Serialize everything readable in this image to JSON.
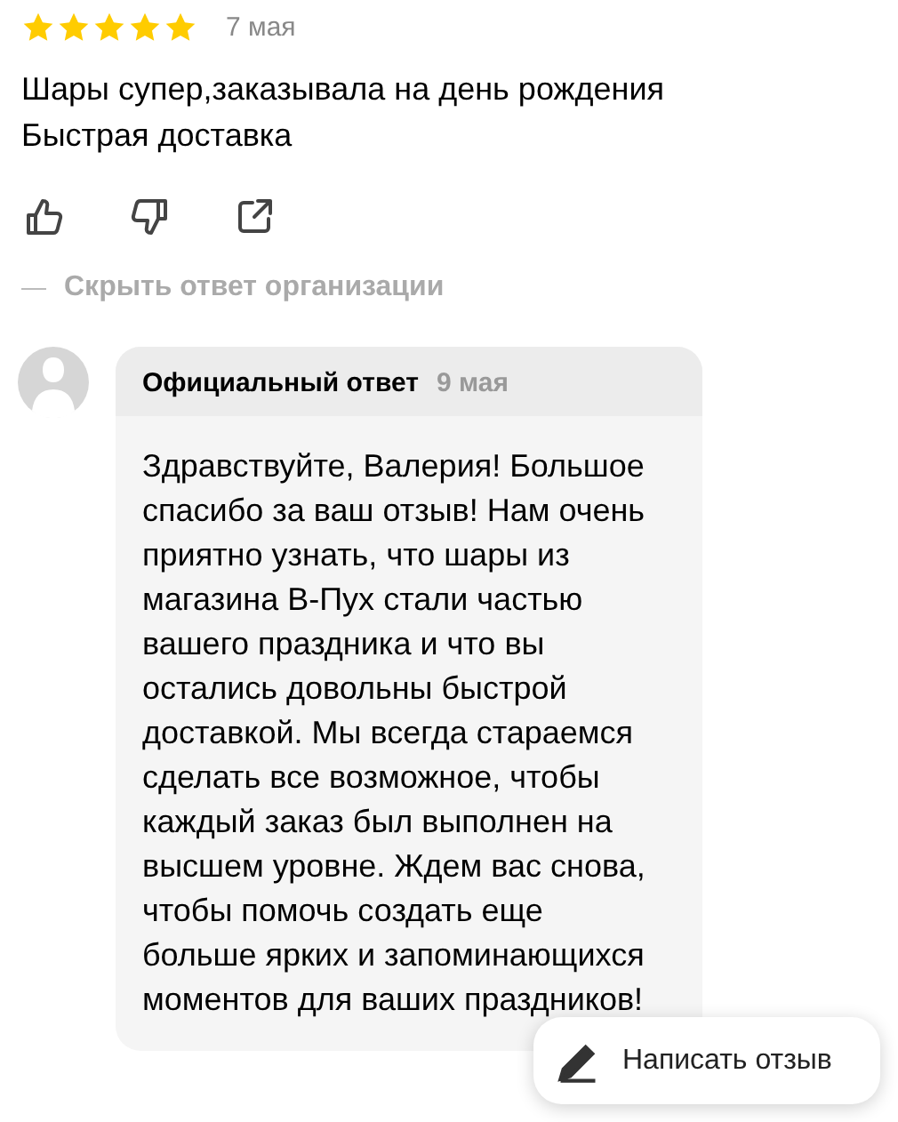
{
  "review": {
    "stars": 5,
    "date": "7 мая",
    "text": "Шары супер,заказывала на день рождения\nБыстрая доставка"
  },
  "actions": [
    {
      "kind": "like"
    },
    {
      "kind": "dislike"
    },
    {
      "kind": "share"
    }
  ],
  "hide_reply_link": "Скрыть ответ организации",
  "official_reply": {
    "title": "Официальный ответ",
    "date": "9 мая",
    "text": "Здравствуйте, Валерия! Большое спасибо за ваш отзыв! Нам очень приятно узнать, что шары из магазина В-Пух стали частью вашего праздника и что вы остались довольны быстрой доставкой. Мы всегда стараемся сделать все возможное, чтобы каждый заказ был выполнен на высшем уровне. Ждем вас снова, чтобы помочь создать еще больше ярких и запоминающихся моментов для ваших праздников!"
  },
  "write_review_button": "Написать отзыв"
}
